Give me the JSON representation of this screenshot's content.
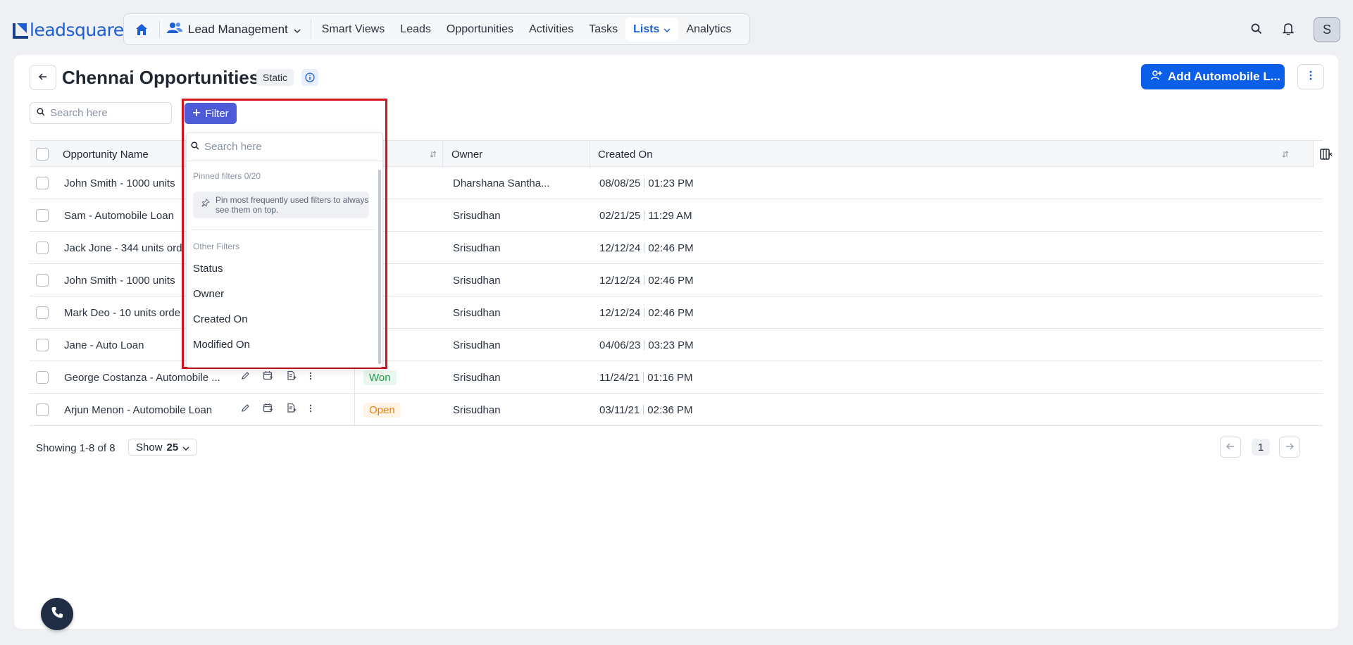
{
  "brand": {
    "logo_text": "leadsquared",
    "accent": "#0b5ee8"
  },
  "nav": {
    "module_label": "Lead Management",
    "items": [
      {
        "label": "Smart Views"
      },
      {
        "label": "Leads"
      },
      {
        "label": "Opportunities"
      },
      {
        "label": "Activities"
      },
      {
        "label": "Tasks"
      },
      {
        "label": "Lists",
        "active": true
      },
      {
        "label": "Analytics"
      }
    ],
    "avatar_initial": "S"
  },
  "page": {
    "title": "Chennai Opportunities",
    "badge": "Static",
    "add_button_label": "Add Automobile L...",
    "search_placeholder": "Search here"
  },
  "filter": {
    "button_label": "Filter",
    "search_placeholder": "Search here",
    "pinned_heading": "Pinned filters 0/20",
    "pinned_tip": "Pin most frequently used filters to always see them on top.",
    "other_heading": "Other Filters",
    "items": [
      "Status",
      "Owner",
      "Created On",
      "Modified On"
    ]
  },
  "table": {
    "columns": [
      "Opportunity Name",
      "Owner",
      "Created On"
    ],
    "rows": [
      {
        "name": "John Smith - 1000 units",
        "status": "",
        "owner": "Dharshana Santha...",
        "date": "08/08/25",
        "time": "01:23 PM"
      },
      {
        "name": "Sam - Automobile Loan",
        "status": "",
        "owner": "Srisudhan",
        "date": "02/21/25",
        "time": "11:29 AM"
      },
      {
        "name": "Jack Jone - 344 units ord",
        "status": "",
        "owner": "Srisudhan",
        "date": "12/12/24",
        "time": "02:46 PM"
      },
      {
        "name": "John Smith - 1000 units",
        "status": "",
        "owner": "Srisudhan",
        "date": "12/12/24",
        "time": "02:46 PM"
      },
      {
        "name": "Mark Deo - 10 units orde",
        "status": "",
        "owner": "Srisudhan",
        "date": "12/12/24",
        "time": "02:46 PM"
      },
      {
        "name": "Jane - Auto Loan",
        "status": "",
        "owner": "Srisudhan",
        "date": "04/06/23",
        "time": "03:23 PM"
      },
      {
        "name": "George Costanza - Automobile ...",
        "status": "Won",
        "owner": "Srisudhan",
        "date": "11/24/21",
        "time": "01:16 PM"
      },
      {
        "name": "Arjun Menon - Automobile Loan",
        "status": "Open",
        "owner": "Srisudhan",
        "date": "03/11/21",
        "time": "02:36 PM"
      }
    ]
  },
  "footer": {
    "showing": "Showing 1-8 of 8",
    "show_prefix": "Show",
    "show_value": "25",
    "page": "1"
  }
}
